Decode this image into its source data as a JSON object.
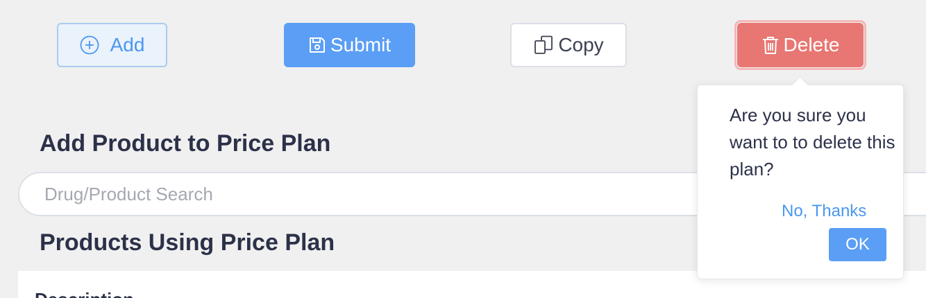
{
  "toolbar": {
    "add_label": "Add",
    "add_icon": "plus-circle-icon",
    "submit_label": "Submit",
    "submit_icon": "save-icon",
    "copy_label": "Copy",
    "copy_icon": "copy-icon",
    "delete_label": "Delete",
    "delete_icon": "trash-icon"
  },
  "colors": {
    "primary": "#5b9ef5",
    "danger": "#e87672",
    "heading": "#2c3149"
  },
  "add_product": {
    "title": "Add Product to Price Plan",
    "search_placeholder": "Drug/Product Search",
    "search_value": ""
  },
  "products_using": {
    "title": "Products Using Price Plan",
    "columns": [
      "Description"
    ]
  },
  "delete_popover": {
    "message": "Are you sure you want to to delete this plan?",
    "cancel_label": "No, Thanks",
    "confirm_label": "OK"
  }
}
